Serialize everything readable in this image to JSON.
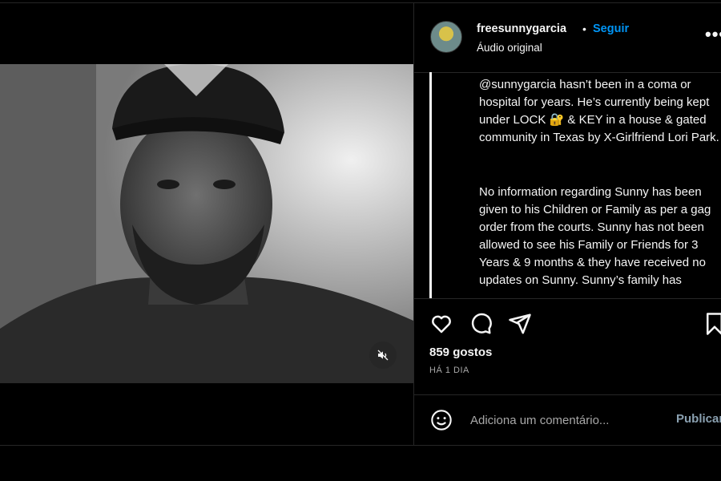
{
  "post": {
    "username": "freesunnygarcia",
    "separator": "•",
    "follow_label": "Seguir",
    "audio_label": "Áudio original",
    "more_label": "•••",
    "caption_paragraphs": [
      "@sunnygarcia hasn’t been in a coma or hospital for years. He’s currently being kept under LOCK 🔐 & KEY in a house & gated community in Texas by X-Girlfriend Lori Park.",
      "No information regarding Sunny has been given to his Children or Family as per a gag order from the courts. Sunny has not been allowed to see his Family or Friends for 3 Years & 9 months & they have received no updates on Sunny. Sunny’s family has"
    ],
    "likes": "859 gostos",
    "date": "HÁ 1 DIA"
  },
  "comment": {
    "placeholder": "Adiciona um comentário...",
    "publish_label": "Publicar"
  },
  "icons": {
    "like": "heart-icon",
    "comment": "comment-icon",
    "share": "share-icon",
    "save": "bookmark-icon",
    "mute": "muted-speaker-icon",
    "emoji": "emoji-icon"
  },
  "colors": {
    "background": "#000000",
    "accent_blue": "#0095f6",
    "secondary_text": "#a8a8a8"
  }
}
